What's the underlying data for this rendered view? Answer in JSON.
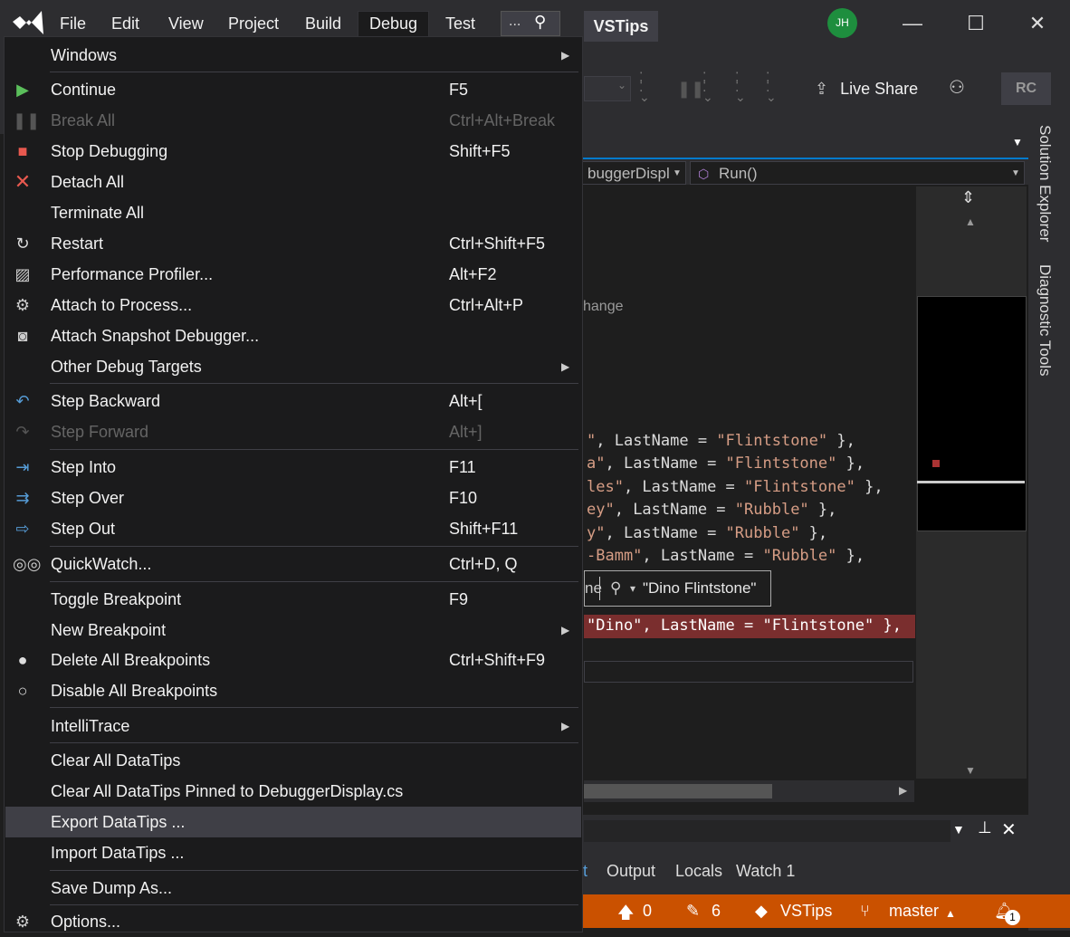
{
  "titlebar": {
    "menus": [
      "File",
      "Edit",
      "View",
      "Project",
      "Build",
      "Debug",
      "Test"
    ],
    "search_more": "...",
    "solution_tab": "VSTips",
    "avatar_initials": "JH"
  },
  "toolbar": {
    "live_share": "Live Share",
    "account_initials": "RC"
  },
  "editor": {
    "nav_left": "buggerDispl",
    "nav_right": "Run()",
    "fragment_change": "hange",
    "code_lines": [
      {
        "pre": "\"",
        "mid": ", LastName = ",
        "str": "\"Flintstone\"",
        "post": " },"
      },
      {
        "pre": "a\"",
        "mid": ", LastName = ",
        "str": "\"Flintstone\"",
        "post": " },"
      },
      {
        "pre": "les\"",
        "mid": ", LastName = ",
        "str": "\"Flintstone\"",
        "post": " },"
      },
      {
        "pre": "ey\"",
        "mid": ", LastName = ",
        "str": "\"Rubble\"",
        "post": " },"
      },
      {
        "pre": "y\"",
        "mid": ", LastName = ",
        "str": "\"Rubble\"",
        "post": " },"
      },
      {
        "pre": "-Bamm\"",
        "mid": ", LastName = ",
        "str": "\"Rubble\"",
        "post": " },"
      }
    ],
    "datatip_prefix": "ne",
    "datatip_value": "\"Dino Flintstone\"",
    "breakpoint_line": "\"Dino\", LastName = \"Flintstone\" },"
  },
  "side_panels": [
    "Solution Explorer",
    "Diagnostic Tools"
  ],
  "bottom_panel": {
    "tabs": [
      "t",
      "Output",
      "Locals",
      "Watch 1"
    ]
  },
  "statusbar": {
    "up_count": "0",
    "edit_count": "6",
    "repo": "VSTips",
    "branch": "master",
    "notifications": "1"
  },
  "debug_menu": {
    "items": [
      {
        "label": "Windows",
        "shortcut": "",
        "submenu": true,
        "icon": "",
        "disabled": false
      },
      {
        "label": "Continue",
        "shortcut": "F5",
        "submenu": false,
        "icon": "play-icon",
        "disabled": false
      },
      {
        "label": "Break All",
        "shortcut": "Ctrl+Alt+Break",
        "submenu": false,
        "icon": "pause-icon",
        "disabled": true
      },
      {
        "label": "Stop Debugging",
        "shortcut": "Shift+F5",
        "submenu": false,
        "icon": "stop-icon",
        "disabled": false
      },
      {
        "label": "Detach All",
        "shortcut": "",
        "submenu": false,
        "icon": "x-icon",
        "disabled": false
      },
      {
        "label": "Terminate All",
        "shortcut": "",
        "submenu": false,
        "icon": "",
        "disabled": false
      },
      {
        "label": "Restart",
        "shortcut": "Ctrl+Shift+F5",
        "submenu": false,
        "icon": "restart-icon",
        "disabled": false
      },
      {
        "label": "Performance Profiler...",
        "shortcut": "Alt+F2",
        "submenu": false,
        "icon": "profiler-icon",
        "disabled": false
      },
      {
        "label": "Attach to Process...",
        "shortcut": "Ctrl+Alt+P",
        "submenu": false,
        "icon": "gears-icon",
        "disabled": false
      },
      {
        "label": "Attach Snapshot Debugger...",
        "shortcut": "",
        "submenu": false,
        "icon": "camera-icon",
        "disabled": false
      },
      {
        "label": "Other Debug Targets",
        "shortcut": "",
        "submenu": true,
        "icon": "",
        "disabled": false
      },
      {
        "label": "Step Backward",
        "shortcut": "Alt+[",
        "submenu": false,
        "icon": "step-backward-icon",
        "disabled": false
      },
      {
        "label": "Step Forward",
        "shortcut": "Alt+]",
        "submenu": false,
        "icon": "step-forward-icon",
        "disabled": true
      },
      {
        "label": "Step Into",
        "shortcut": "F11",
        "submenu": false,
        "icon": "step-into-icon",
        "disabled": false
      },
      {
        "label": "Step Over",
        "shortcut": "F10",
        "submenu": false,
        "icon": "step-over-icon",
        "disabled": false
      },
      {
        "label": "Step Out",
        "shortcut": "Shift+F11",
        "submenu": false,
        "icon": "step-out-icon",
        "disabled": false
      },
      {
        "label": "QuickWatch...",
        "shortcut": "Ctrl+D, Q",
        "submenu": false,
        "icon": "glasses-icon",
        "disabled": false
      },
      {
        "label": "Toggle Breakpoint",
        "shortcut": "F9",
        "submenu": false,
        "icon": "",
        "disabled": false
      },
      {
        "label": "New Breakpoint",
        "shortcut": "",
        "submenu": true,
        "icon": "",
        "disabled": false
      },
      {
        "label": "Delete All Breakpoints",
        "shortcut": "Ctrl+Shift+F9",
        "submenu": false,
        "icon": "delete-breakpoints-icon",
        "disabled": false
      },
      {
        "label": "Disable All Breakpoints",
        "shortcut": "",
        "submenu": false,
        "icon": "disable-breakpoints-icon",
        "disabled": false
      },
      {
        "label": "IntelliTrace",
        "shortcut": "",
        "submenu": true,
        "icon": "",
        "disabled": false
      },
      {
        "label": "Clear All DataTips",
        "shortcut": "",
        "submenu": false,
        "icon": "",
        "disabled": false
      },
      {
        "label": "Clear All DataTips Pinned to DebuggerDisplay.cs",
        "shortcut": "",
        "submenu": false,
        "icon": "",
        "disabled": false
      },
      {
        "label": "Export DataTips ...",
        "shortcut": "",
        "submenu": false,
        "icon": "",
        "disabled": false,
        "highlighted": true
      },
      {
        "label": "Import DataTips ...",
        "shortcut": "",
        "submenu": false,
        "icon": "",
        "disabled": false
      },
      {
        "label": "Save Dump As...",
        "shortcut": "",
        "submenu": false,
        "icon": "",
        "disabled": false
      },
      {
        "label": "Options...",
        "shortcut": "",
        "submenu": false,
        "icon": "gear-icon",
        "disabled": false
      }
    ]
  },
  "colors": {
    "accent": "#007acc",
    "statusbar": "#ca5100",
    "breakpoint": "#7a2e2e",
    "play": "#5bbf5b",
    "stop": "#e8594f"
  }
}
